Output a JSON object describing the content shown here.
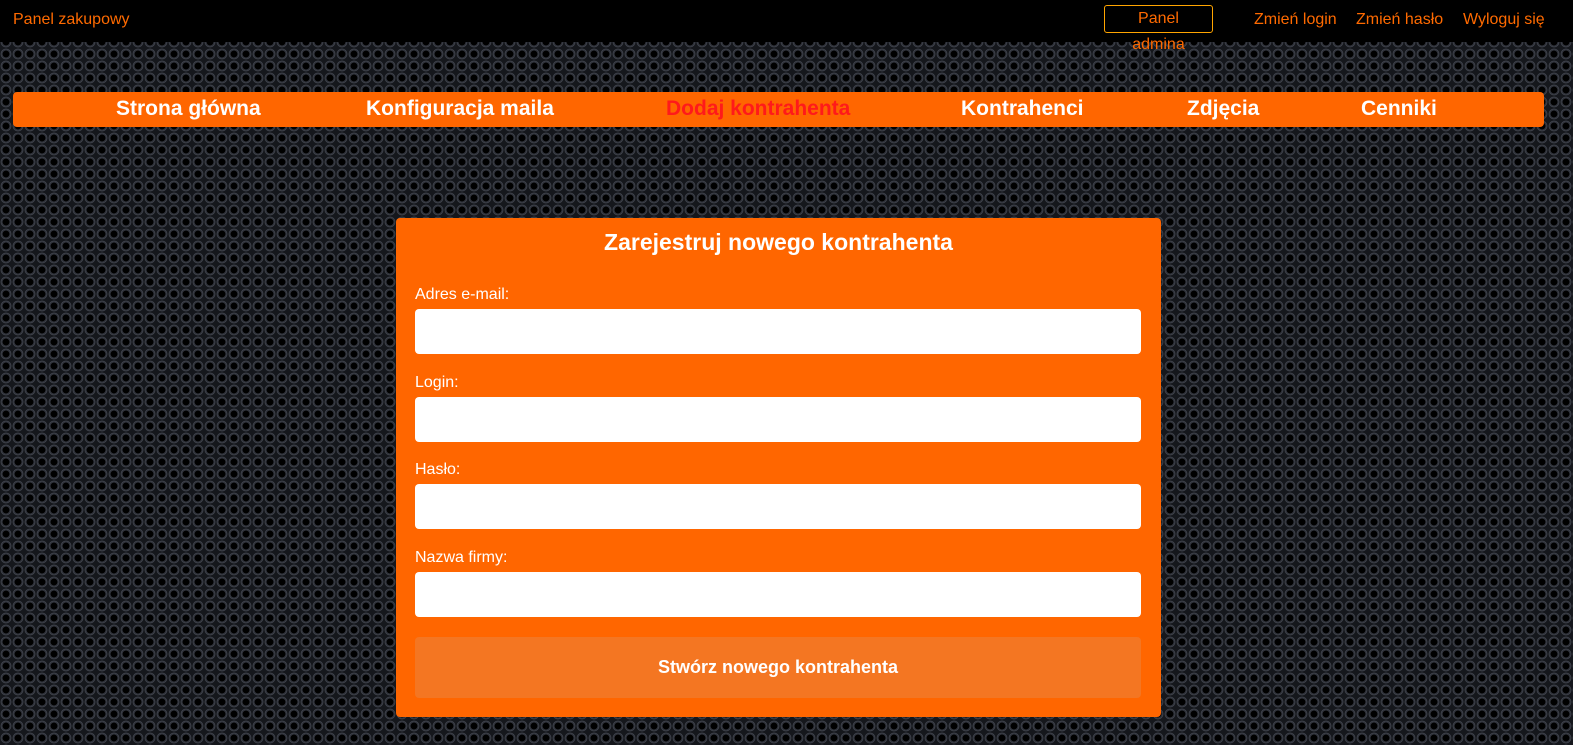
{
  "topbar": {
    "brand": "Panel zakupowy",
    "admin_button": "Panel admina",
    "links": [
      "Zmień login",
      "Zmień hasło",
      "Wyloguj się"
    ]
  },
  "nav": {
    "items": [
      "Strona główna",
      "Konfiguracja maila",
      "Dodaj kontrahenta",
      "Kontrahenci",
      "Zdjęcia",
      "Cenniki"
    ],
    "active": "Dodaj kontrahenta"
  },
  "form": {
    "title": "Zarejestruj nowego kontrahenta",
    "fields": [
      {
        "label": "Adres e-mail:",
        "value": ""
      },
      {
        "label": "Login:",
        "value": ""
      },
      {
        "label": "Hasło:",
        "value": ""
      },
      {
        "label": "Nazwa firmy:",
        "value": ""
      }
    ],
    "submit_label": "Stwórz nowego kontrahenta"
  },
  "colors": {
    "accent": "#ff6600",
    "active_nav": "#ff1a1a",
    "topbar_bg": "#000000"
  }
}
